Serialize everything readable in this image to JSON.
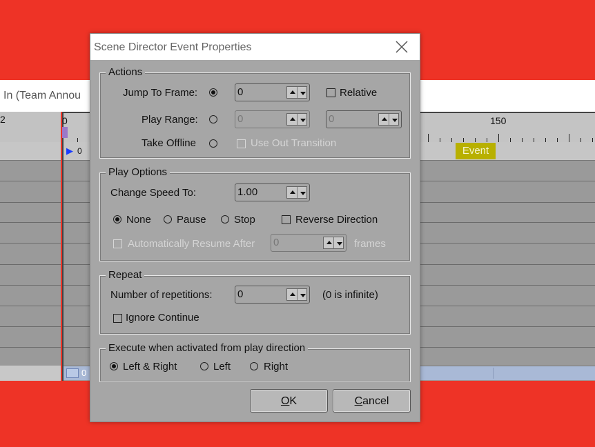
{
  "background": {
    "window_title": "In (Team Annou",
    "ruler_left_label": "2",
    "ruler_start_label": "0",
    "ruler_150_label": "150",
    "playhead_value": "0",
    "event_label": "Event",
    "scroll_value": "0"
  },
  "dialog": {
    "title": "Scene Director Event Properties",
    "actions": {
      "group_label": "Actions",
      "jump_to_frame": {
        "label": "Jump To Frame:",
        "value": "0",
        "checked": true
      },
      "relative_label": "Relative",
      "play_range": {
        "label": "Play Range:",
        "from": "0",
        "to": "0"
      },
      "take_offline": {
        "label": "Take Offline"
      },
      "use_out_transition_label": "Use Out Transition"
    },
    "play_options": {
      "group_label": "Play Options",
      "change_speed_label": "Change Speed To:",
      "change_speed_value": "1.00",
      "none_label": "None",
      "pause_label": "Pause",
      "stop_label": "Stop",
      "reverse_label": "Reverse Direction",
      "auto_resume_label": "Automatically Resume After",
      "auto_resume_value": "0",
      "frames_label": "frames"
    },
    "repeat": {
      "group_label": "Repeat",
      "repetitions_label": "Number of repetitions:",
      "repetitions_value": "0",
      "infinite_note": "(0 is infinite)",
      "ignore_continue_label": "Ignore Continue"
    },
    "execute": {
      "group_label": "Execute when activated from play direction",
      "left_right_label": "Left & Right",
      "left_label": "Left",
      "right_label": "Right"
    },
    "buttons": {
      "ok_prefix": "O",
      "ok_rest": "K",
      "cancel_prefix": "C",
      "cancel_rest": "ancel"
    }
  },
  "icons": {
    "close": "close-icon",
    "spin_up": "arrow-up-icon",
    "spin_down": "arrow-down-icon",
    "playhead": "play-marker-icon"
  },
  "colors": {
    "background_red": "#ee3326",
    "dialog_gray": "#a6a6a6",
    "event_yellow": "#b8b000",
    "scrollbar_blue": "#a9b9d6"
  }
}
